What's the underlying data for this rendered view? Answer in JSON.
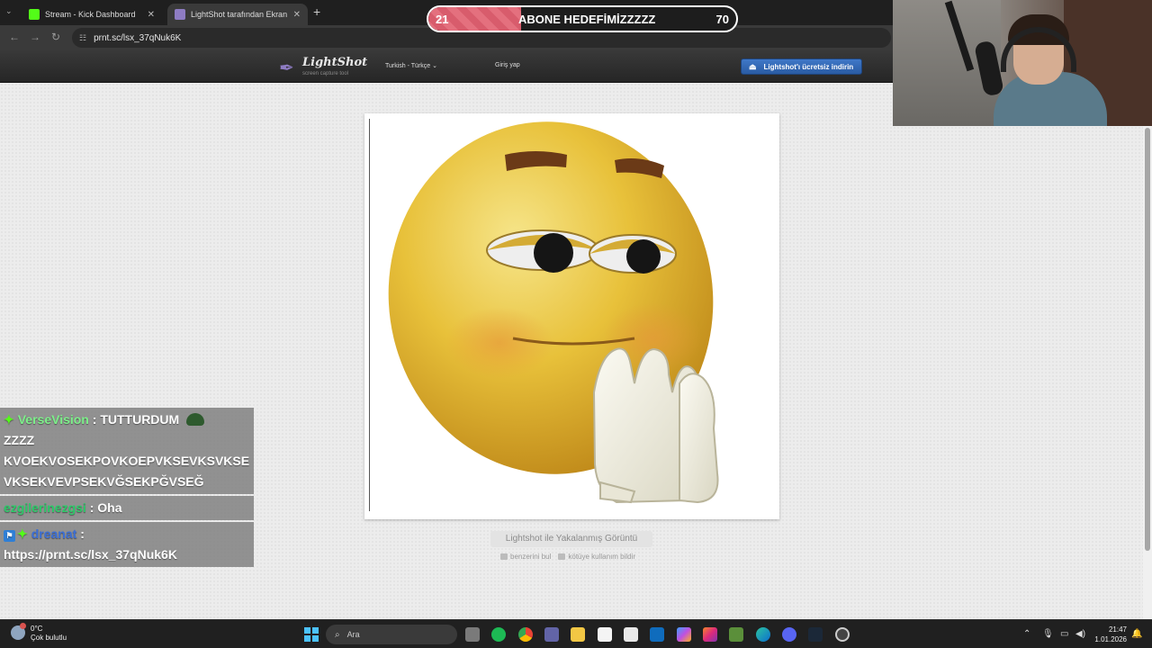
{
  "browser": {
    "tabs": [
      {
        "title": "Stream - Kick Dashboard",
        "favicon_color": "#53fc18"
      },
      {
        "title": "LightShot tarafından Ekran Görü",
        "favicon_color": "#8e7cc3"
      }
    ],
    "url": "prnt.sc/lsx_37qNuk6K"
  },
  "goal": {
    "current": "21",
    "label": "ABONE HEDEFİMİZZZZZ",
    "target": "70",
    "progress": 0.3
  },
  "lightshot": {
    "logo_name": "LightShot",
    "logo_tagline": "screen capture tool",
    "language": "Turkish - Türkçe",
    "login": "Giriş yap",
    "download_button": "Lightshot'ı ücretsiz indirin",
    "caption": "Lightshot ile Yakalanmış Görüntü",
    "find_similar": "benzerini bul",
    "report_abuse": "kötüye kullanım bildir"
  },
  "chat": [
    {
      "user": "VerseVision",
      "user_color": "#7df08a",
      "text": ": TUTTURDUM",
      "cont": "ZZZZ KVOEKVOSEKPOVKOEPVKSEVKSVKSE VKSEKVEVPSEKVĞSEKPĞVSEĞ"
    },
    {
      "user": "ezgilerinezgsi",
      "user_color": "#2ec96a",
      "text": ": Oha"
    },
    {
      "user": "dreanat",
      "user_color": "#3b6fd6",
      "text": ":",
      "cont": "https://prnt.sc/lsx_37qNuk6K"
    }
  ],
  "taskbar": {
    "weather_temp": "0°C",
    "weather_desc": "Çok bulutlu",
    "weather_badge": "2",
    "search_placeholder": "Ara",
    "time": "21:47",
    "date": "1.01.2026"
  }
}
